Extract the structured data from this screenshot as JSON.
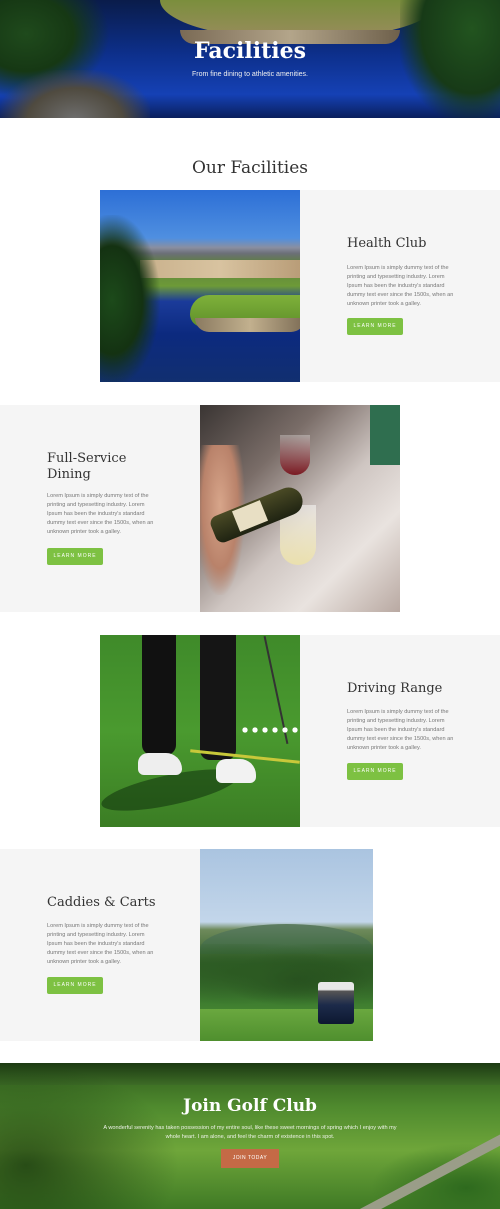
{
  "hero": {
    "title": "Facilities",
    "subtitle": "From fine dining to athletic amenities."
  },
  "facilities_section": {
    "title": "Our Facilities",
    "items": [
      {
        "title": "Health Club",
        "description": "Lorem Ipsum is simply dummy text of the printing and typesetting industry. Lorem Ipsum has been the industry's standard dummy text ever since the 1500s, when an unknown printer took a galley.",
        "button": "LEARN MORE"
      },
      {
        "title": "Full-Service Dining",
        "description": "Lorem Ipsum is simply dummy text of the printing and typesetting industry. Lorem Ipsum has been the industry's standard dummy text ever since the 1500s, when an unknown printer took a galley.",
        "button": "LEARN MORE"
      },
      {
        "title": "Driving Range",
        "description": "Lorem Ipsum is simply dummy text of the printing and typesetting industry. Lorem Ipsum has been the industry's standard dummy text ever since the 1500s, when an unknown printer took a galley.",
        "button": "LEARN MORE"
      },
      {
        "title": "Caddies & Carts",
        "description": "Lorem Ipsum is simply dummy text of the printing and typesetting industry. Lorem Ipsum has been the industry's standard dummy text ever since the 1500s, when an unknown printer took a galley.",
        "button": "LEARN MORE"
      }
    ]
  },
  "join": {
    "title": "Join Golf Club",
    "text": "A wonderful serenity has taken possession of my entire soul, like these sweet mornings of spring which I enjoy with my whole heart. I am alone, and feel the charm of existence in this spot.",
    "button": "JOIN TODAY"
  },
  "colors": {
    "accent_green": "#7dc142",
    "join_button": "#c46a46",
    "panel_gray": "#f5f5f5"
  }
}
